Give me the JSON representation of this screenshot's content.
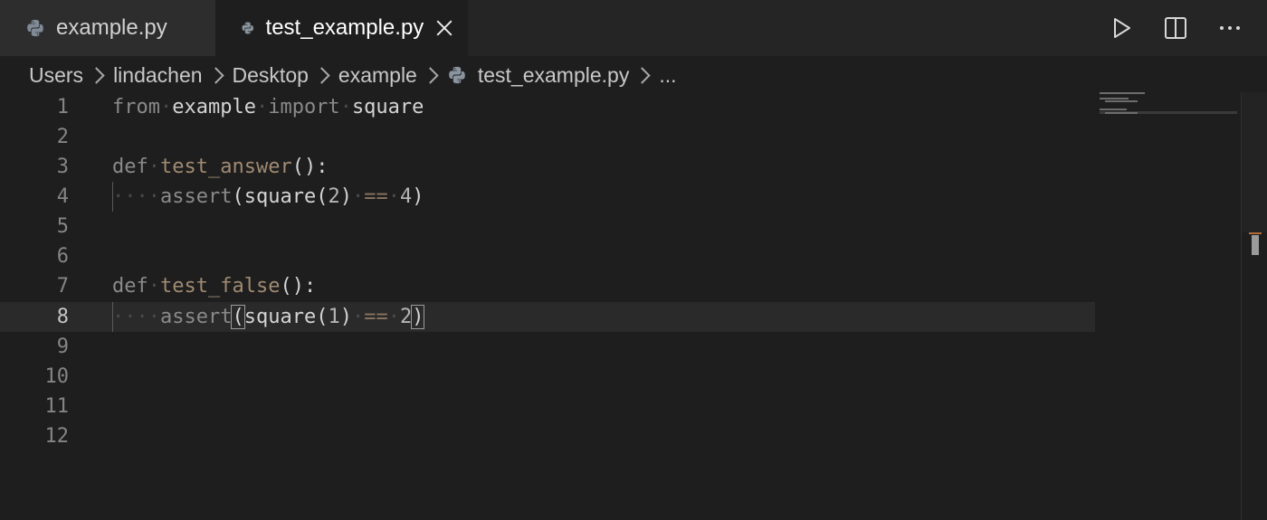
{
  "tabs": [
    {
      "label": "example.py",
      "active": false
    },
    {
      "label": "test_example.py",
      "active": true
    }
  ],
  "breadcrumb": {
    "items": [
      "Users",
      "lindachen",
      "Desktop",
      "example",
      "test_example.py",
      "..."
    ]
  },
  "editor": {
    "line_numbers": [
      "1",
      "2",
      "3",
      "4",
      "5",
      "6",
      "7",
      "8",
      "9",
      "10",
      "11",
      "12"
    ],
    "current_line": 8,
    "tokens": {
      "l1_from": "from",
      "l1_module": "example",
      "l1_import": "import",
      "l1_name": "square",
      "l3_def": "def",
      "l3_fn": "test_answer",
      "l3_rest": "():",
      "l4_ws": "···",
      "l4_assert": "assert",
      "l4_a": "(square(",
      "l4_n1": "2",
      "l4_b": ")",
      "l4_op": "==",
      "l4_n2": "4",
      "l4_c": ")",
      "l7_def": "def",
      "l7_fn": "test_false",
      "l7_rest": "():",
      "l8_ws": "···",
      "l8_assert": "assert",
      "l8_open": "(",
      "l8_a": "square(",
      "l8_n1": "1",
      "l8_b": ")",
      "l8_op": "==",
      "l8_n2": "2",
      "l8_close": ")"
    }
  },
  "icons": {
    "file_type": "python-icon",
    "actions": [
      "run-icon",
      "split-editor-icon",
      "more-actions-icon"
    ]
  },
  "colors": {
    "editor_bg": "#1e1e1e",
    "tabbar_bg": "#252526",
    "keyword": "#8a8a8a",
    "function": "#a08a72"
  }
}
